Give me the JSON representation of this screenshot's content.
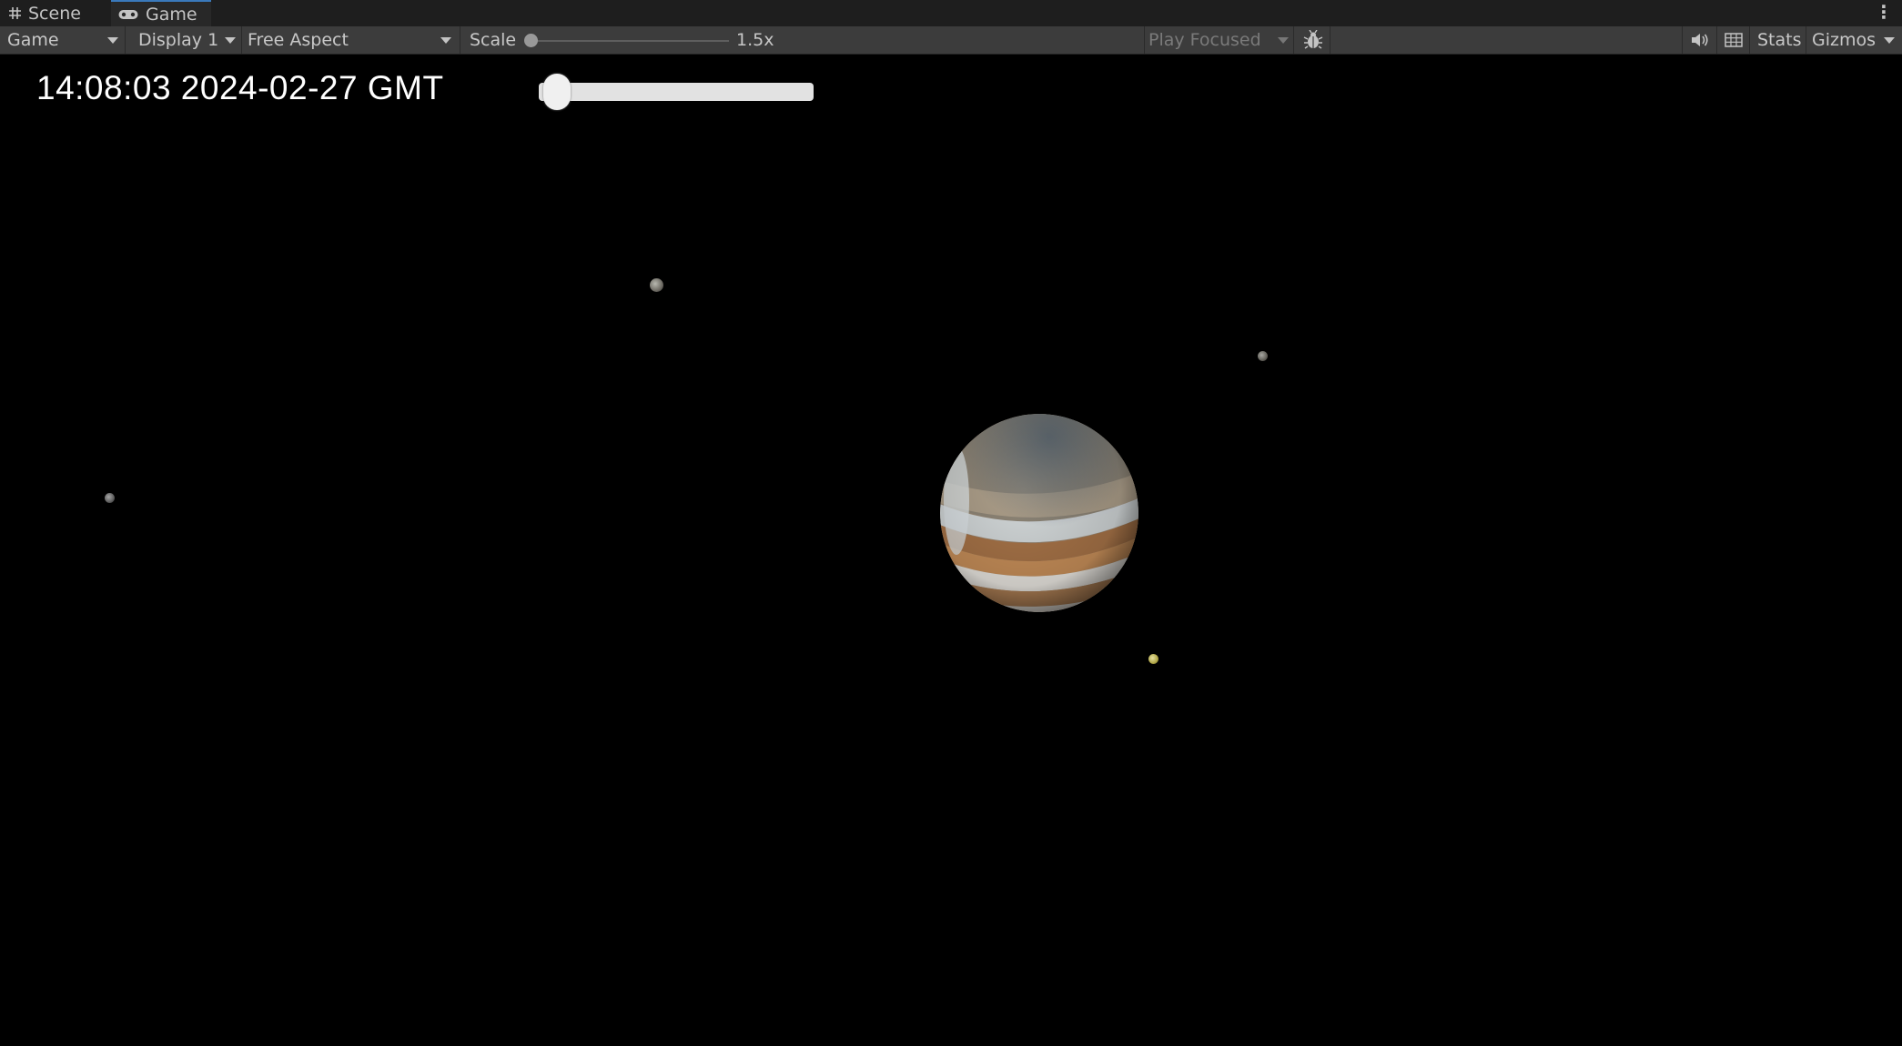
{
  "tabs": [
    {
      "label": "Scene",
      "icon": "grid-icon"
    },
    {
      "label": "Game",
      "icon": "gamepad-icon",
      "active": true
    }
  ],
  "toolbar": {
    "view_mode": "Game",
    "display": "Display 1",
    "aspect": "Free Aspect",
    "scale_label": "Scale",
    "scale_value": "1.5x",
    "scale_fraction": 0.0,
    "play_mode": "Play Focused",
    "stats_label": "Stats",
    "gizmos_label": "Gizmos",
    "icons": [
      "bug-icon",
      "speaker-icon",
      "grid-icon"
    ]
  },
  "game": {
    "time_text": "14:08:03 2024-02-27 GMT",
    "time_slider_fraction": 0.02
  },
  "colors": {
    "active_tab_accent": "#3a79bb",
    "toolbar_bg": "#3c3c3c",
    "tabbar_bg": "#1e1e1e",
    "background": "#000000"
  }
}
